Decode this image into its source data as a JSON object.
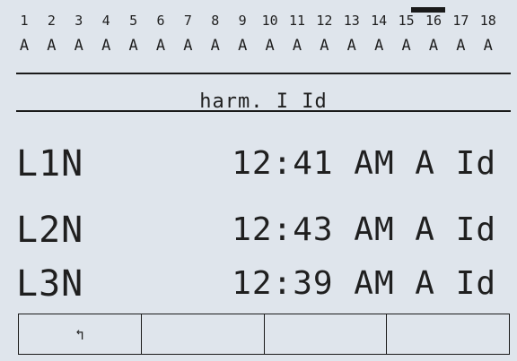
{
  "header": {
    "channels": [
      {
        "num": "1",
        "label": "A"
      },
      {
        "num": "2",
        "label": "A"
      },
      {
        "num": "3",
        "label": "A"
      },
      {
        "num": "4",
        "label": "A"
      },
      {
        "num": "5",
        "label": "A"
      },
      {
        "num": "6",
        "label": "A"
      },
      {
        "num": "7",
        "label": "A"
      },
      {
        "num": "8",
        "label": "A"
      },
      {
        "num": "9",
        "label": "A"
      },
      {
        "num": "10",
        "label": "A"
      },
      {
        "num": "11",
        "label": "A"
      },
      {
        "num": "12",
        "label": "A"
      },
      {
        "num": "13",
        "label": "A"
      },
      {
        "num": "14",
        "label": "A"
      },
      {
        "num": "15",
        "label": "A"
      },
      {
        "num": "16",
        "label": "A"
      },
      {
        "num": "17",
        "label": "A"
      },
      {
        "num": "18",
        "label": "A"
      }
    ]
  },
  "page": {
    "title": "harm. I Id"
  },
  "rows": [
    {
      "phase": "L1N",
      "value": "12:41 AM A Id"
    },
    {
      "phase": "L2N",
      "value": "12:43 AM A Id"
    },
    {
      "phase": "L3N",
      "value": "12:39 AM A Id"
    }
  ],
  "softkeys": [
    {
      "label": "↰",
      "name": "back-softkey"
    },
    {
      "label": "",
      "name": "softkey-2"
    },
    {
      "label": "",
      "name": "softkey-3"
    },
    {
      "label": "",
      "name": "softkey-4"
    }
  ],
  "colors": {
    "background": "#dfe5ec",
    "foreground": "#1f1f1f"
  }
}
